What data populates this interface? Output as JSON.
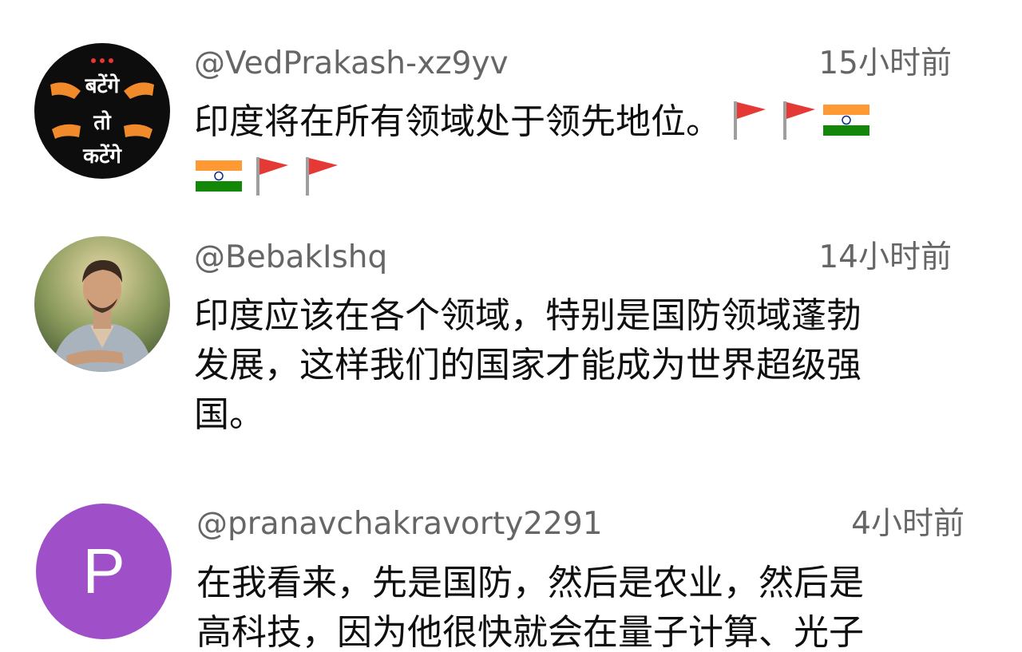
{
  "comments": [
    {
      "handle": "@VedPrakash-xz9yv",
      "time": "15小时前",
      "avatar": {
        "type": "logo",
        "lines": [
          "बटेंगे",
          "तो",
          "कटेंगे"
        ],
        "bg": "#0d0d0d",
        "accent": "#f08a2a"
      },
      "text_lines": [
        "印度将在所有领域处于领先地位。"
      ],
      "emojis_line1": [
        "triangular-flag",
        "triangular-flag",
        "india-flag"
      ],
      "emojis_line2": [
        "india-flag",
        "triangular-flag",
        "triangular-flag"
      ]
    },
    {
      "handle": "@BebakIshq",
      "time": "14小时前",
      "avatar": {
        "type": "photo"
      },
      "text_lines": [
        "印度应该在各个领域，特别是国防领域蓬勃",
        "发展，这样我们的国家才能成为世界超级强",
        "国。"
      ]
    },
    {
      "handle": "@pranavchakravorty2291",
      "time": "4小时前",
      "avatar": {
        "type": "letter",
        "letter": "P",
        "bg": "#9f4fc8"
      },
      "text_lines": [
        "在我看来，先是国防，然后是农业，然后是",
        "高科技，因为他很快就会在量子计算、光子"
      ]
    }
  ]
}
